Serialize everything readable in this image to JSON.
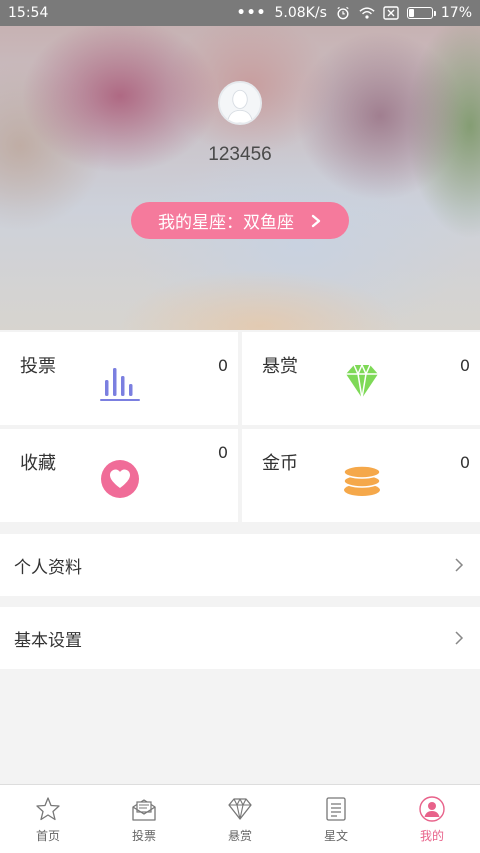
{
  "status_bar": {
    "time": "15:54",
    "dots": "•••",
    "speed": "5.08K/s",
    "battery": "17%"
  },
  "profile": {
    "username": "123456",
    "zodiac_button": "我的星座：双鱼座"
  },
  "stats": [
    {
      "label": "投票",
      "count": "0",
      "icon": "bar-chart-icon"
    },
    {
      "label": "悬赏",
      "count": "0",
      "icon": "diamond-icon"
    },
    {
      "label": "收藏",
      "count": "0",
      "icon": "heart-icon"
    },
    {
      "label": "金币",
      "count": "0",
      "icon": "coins-icon"
    }
  ],
  "menu": {
    "profile_label": "个人资料",
    "settings_label": "基本设置"
  },
  "nav": [
    {
      "label": "首页",
      "icon": "star-icon"
    },
    {
      "label": "投票",
      "icon": "mail-vote-icon"
    },
    {
      "label": "悬赏",
      "icon": "diamond-icon"
    },
    {
      "label": "星文",
      "icon": "document-icon"
    },
    {
      "label": "我的",
      "icon": "profile-icon",
      "active": true
    }
  ],
  "colors": {
    "accent": "#f57a9c",
    "active_nav": "#e8628a",
    "bar_icon": "#7b7fe0",
    "diamond": "#7ed957",
    "heart": "#f06c98",
    "coins": "#f5a84a"
  }
}
